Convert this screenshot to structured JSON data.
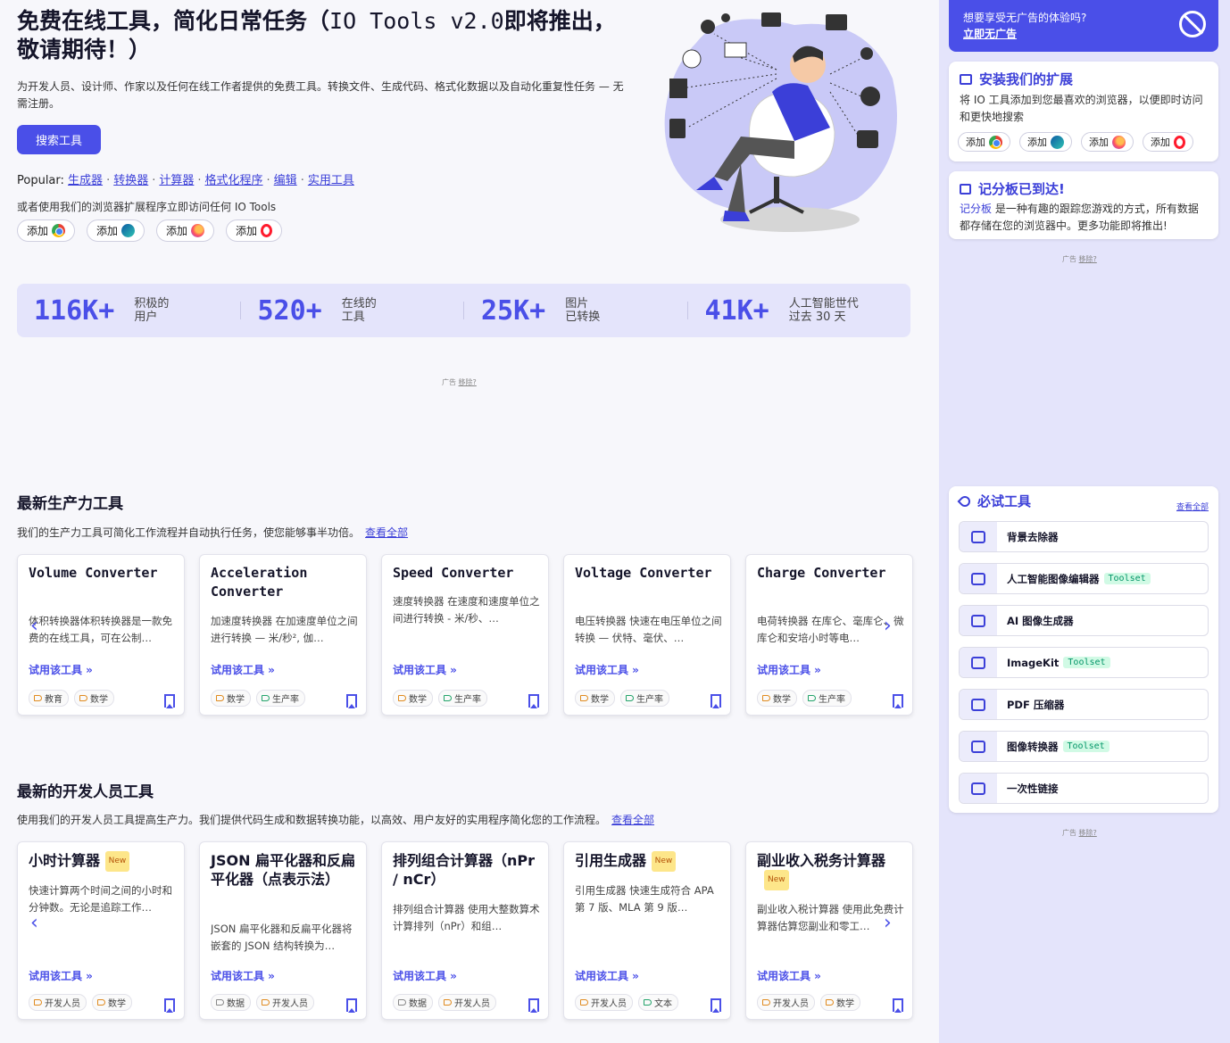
{
  "hero": {
    "title_a": "免费在线工具，简化日常任务（",
    "title_b": "IO Tools v2.0",
    "title_c": "即将推出，敬请期待！）",
    "description": "为开发人员、设计师、作家以及任何在线工作者提供的免费工具。转换文件、生成代码、格式化数据以及自动化重复性任务 — 无需注册。",
    "search_button": "搜索工具",
    "popular_label": "Popular:",
    "popular_links": [
      "生成器",
      "转换器",
      "计算器",
      "格式化程序",
      "编辑",
      "实用工具"
    ],
    "extension_note": "或者使用我们的浏览器扩展程序立即访问任何 IO Tools",
    "add_label": "添加"
  },
  "stats": [
    {
      "value": "116K+",
      "label": "积极的\n用户"
    },
    {
      "value": "520+",
      "label": "在线的\n工具"
    },
    {
      "value": "25K+",
      "label": "图片\n已转换"
    },
    {
      "value": "41K+",
      "label": "人工智能世代\n过去 30 天"
    }
  ],
  "ad": {
    "label": "广告",
    "remove": "移除?"
  },
  "productivity": {
    "title": "最新生产力工具",
    "description": "我们的生产力工具可简化工作流程并自动执行任务，使您能够事半功倍。",
    "see_all": "查看全部",
    "try_label": "试用该工具 »",
    "cards": [
      {
        "title": "Volume Converter",
        "desc": "体积转换器体积转换器是一款免费的在线工具，可在公制…",
        "tags": [
          "教育",
          "数学"
        ]
      },
      {
        "title": "Acceleration Converter",
        "desc": "加速度转换器 在加速度单位之间进行转换 — 米/秒², 伽…",
        "tags": [
          "数学",
          "生产率"
        ]
      },
      {
        "title": "Speed Converter",
        "desc": "速度转换器 在速度和速度单位之间进行转换 - 米/秒、…",
        "tags": [
          "数学",
          "生产率"
        ]
      },
      {
        "title": "Voltage Converter",
        "desc": "电压转换器 快速在电压单位之间转换 — 伏特、毫伏、…",
        "tags": [
          "数学",
          "生产率"
        ]
      },
      {
        "title": "Charge Converter",
        "desc": "电荷转换器 在库仑、毫库仑、微库仑和安培小时等电…",
        "tags": [
          "数学",
          "生产率"
        ]
      }
    ]
  },
  "developer": {
    "title": "最新的开发人员工具",
    "description": "使用我们的开发人员工具提高生产力。我们提供代码生成和数据转换功能，以高效、用户友好的实用程序简化您的工作流程。",
    "see_all": "查看全部",
    "new_badge": "New",
    "cards": [
      {
        "title": "小时计算器",
        "desc": "快速计算两个时间之间的小时和分钟数。无论是追踪工作…",
        "tags": [
          "开发人员",
          "数学"
        ]
      },
      {
        "title": "JSON 扁平化器和反扁平化器（点表示法）",
        "desc": "JSON 扁平化器和反扁平化器将嵌套的 JSON 结构转换为…",
        "tags": [
          "数据",
          "开发人员"
        ]
      },
      {
        "title": "排列组合计算器（nPr / nCr）",
        "desc": "排列组合计算器 使用大整数算术计算排列（nPr）和组…",
        "tags": [
          "数据",
          "开发人员"
        ]
      },
      {
        "title": "引用生成器",
        "desc": "引用生成器 快速生成符合 APA 第 7 版、MLA 第 9 版…",
        "tags": [
          "开发人员",
          "文本"
        ]
      },
      {
        "title": "副业收入税务计算器",
        "desc": "副业收入税计算器 使用此免费计算器估算您副业和零工…",
        "tags": [
          "开发人员",
          "数学"
        ]
      }
    ]
  },
  "sidebar": {
    "promo_question": "想要享受无广告的体验吗?",
    "promo_link": "立即无广告",
    "extension": {
      "title": "安装我们的扩展",
      "text": "将 IO 工具添加到您最喜欢的浏览器，以便即时访问和更快地搜索"
    },
    "scoreboard": {
      "title": "记分板已到达!",
      "link": "记分板",
      "text": " 是一种有趣的跟踪您游戏的方式，所有数据都存储在您的浏览器中。更多功能即将推出!"
    },
    "must_try": {
      "title": "必试工具",
      "see_all": "查看全部",
      "toolset_label": "Toolset",
      "items": [
        {
          "name": "背景去除器"
        },
        {
          "name": "人工智能图像编辑器"
        },
        {
          "name": "AI 图像生成器"
        },
        {
          "name": "ImageKit"
        },
        {
          "name": "PDF 压缩器"
        },
        {
          "name": "图像转换器"
        },
        {
          "name": "一次性链接"
        }
      ]
    }
  }
}
